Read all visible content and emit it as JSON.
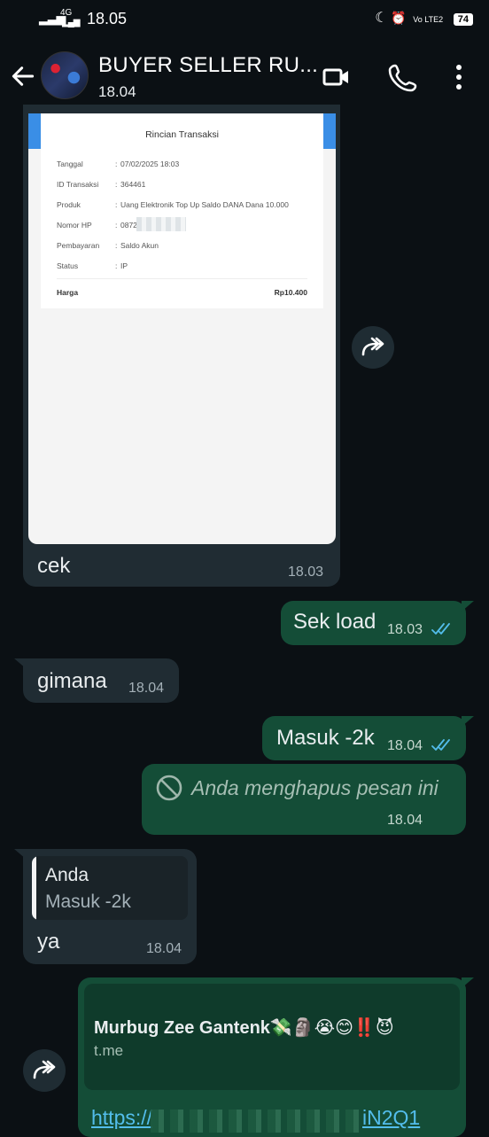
{
  "status_bar": {
    "network": "4G",
    "time": "18.05",
    "volte": "Vo LTE2",
    "battery": "74"
  },
  "header": {
    "title": "BUYER SELLER RU...",
    "subtitle": "18.04"
  },
  "receipt": {
    "title": "Rincian Transaksi",
    "rows": [
      {
        "label": "Tanggal",
        "value": "07/02/2025 18:03"
      },
      {
        "label": "ID Transaksi",
        "value": "364461"
      },
      {
        "label": "Produk",
        "value": "Uang Elektronik Top Up Saldo DANA Dana 10.000"
      },
      {
        "label": "Nomor HP",
        "value": "0872"
      },
      {
        "label": "Pembayaran",
        "value": "Saldo Akun"
      },
      {
        "label": "Status",
        "value": "IP"
      }
    ],
    "total_label": "Harga",
    "total_value": "Rp10.400",
    "separator": ":"
  },
  "messages": {
    "m1": {
      "text": "cek",
      "time": "18.03"
    },
    "m2": {
      "text": "Sek load",
      "time": "18.03"
    },
    "m3": {
      "text": "gimana",
      "time": "18.04"
    },
    "m4": {
      "text": "Masuk -2k",
      "time": "18.04"
    },
    "m5": {
      "text": "Anda menghapus pesan ini",
      "time": "18.04"
    },
    "m6": {
      "quote_author": "Anda",
      "quote_text": "Masuk -2k",
      "text": "ya",
      "time": "18.04"
    },
    "m7": {
      "preview_title": "Murbug Zee Gantenk",
      "preview_emoji": "💸🗿😭😊‼️😈",
      "preview_domain": "t.me",
      "link_start": "https://",
      "link_end": "iN2Q1"
    }
  },
  "colors": {
    "background": "#0b1014",
    "incoming": "#202c33",
    "outgoing": "#144d37",
    "read_ticks": "#53bdeb",
    "link": "#53bdeb"
  }
}
